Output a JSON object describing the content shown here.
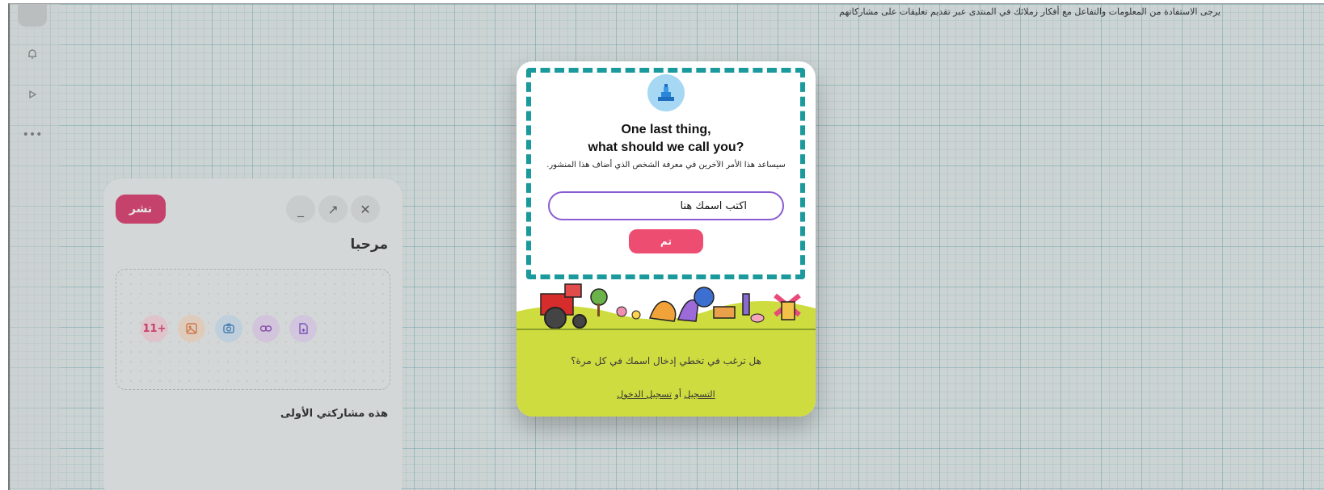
{
  "banner": {
    "text": "يرجى الاستفادة من المعلومات والتفاعل مع أفكار زملائك في المنتدى عبر تقديم تعليقات على مشاركاتهم"
  },
  "left_rail": {
    "items": [
      {
        "icon": "bell-icon"
      },
      {
        "icon": "play-icon"
      },
      {
        "icon": "more-icon",
        "label": "•••"
      }
    ]
  },
  "composer": {
    "publish_label": "نشر",
    "title": "مرحبا",
    "body": "هذه مشاركتي الأولى",
    "more_count": "11+",
    "window_controls": {
      "minimize": "_",
      "expand": "↗",
      "close": "✕"
    }
  },
  "modal": {
    "title_line1": "One last thing,",
    "title_line2": "what should we call you?",
    "subtitle": "سيساعد هذا الأمر الآخرين في معرفة الشخص الذي أضاف هذا المنشور.",
    "name_input_value": "اكتب اسمك هنا",
    "done_label": "تم",
    "skip_text": "هل ترغب في تخطي إدخال اسمك في كل مرة؟",
    "signup_label": "التسجيل",
    "or_label": "أو",
    "login_label": "تسجيل الدخول"
  },
  "colors": {
    "accent_pink": "#ee4d72",
    "publish_pink": "#d6356a",
    "dashed_teal": "#1a9a9c",
    "input_border": "#8a5bd1",
    "scene_green": "#cfdc3f"
  }
}
